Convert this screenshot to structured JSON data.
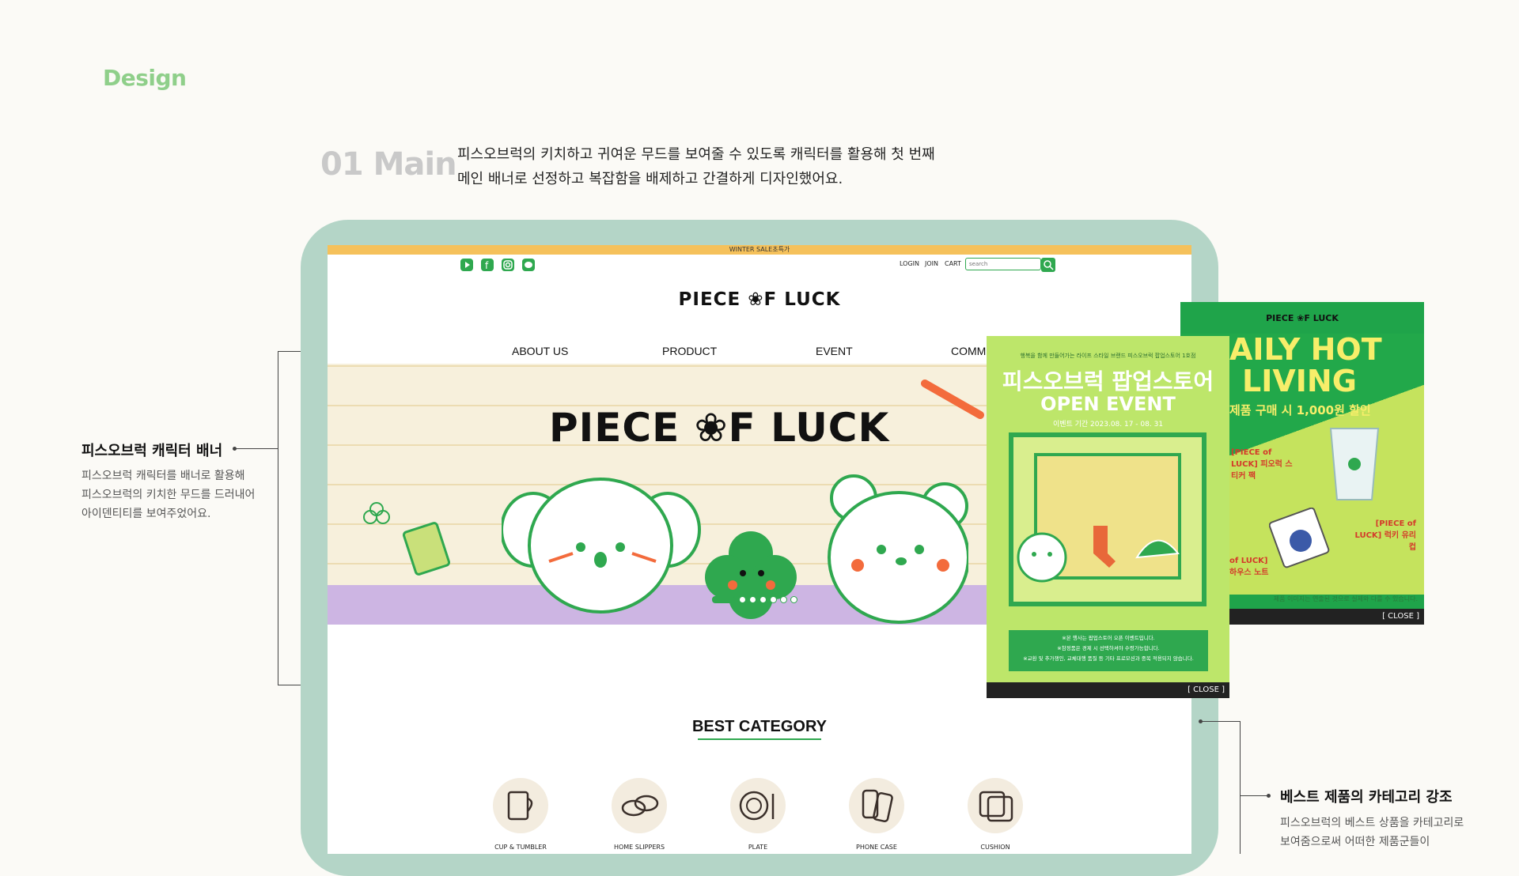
{
  "section": "Design",
  "number": "01 Main",
  "intro": [
    "피스오브럭의 키치하고 귀여운 무드를 보여줄 수 있도록 캐릭터를 활용해 첫 번째",
    "메인 배너로 선정하고 복잡함을 배제하고 간결하게 디자인했어요."
  ],
  "annotations": {
    "left": {
      "title": "피스오브럭 캐릭터 배너",
      "lines": [
        "피스오브럭 캐릭터를 배너로 활용해",
        "피스오브럭의 키치한 무드를 드러내어",
        "아이덴티티를 보여주었어요."
      ]
    },
    "right": {
      "title": "베스트 제품의 카테고리 강조",
      "lines": [
        "피스오브럭의 베스트 상품을 카테고리로",
        "보여줌으로써 어떠한 제품군들이"
      ]
    }
  },
  "site": {
    "promo_bar": "WINTER SALE초특가",
    "social_icons": [
      "youtube-icon",
      "facebook-icon",
      "instagram-icon",
      "talk-icon"
    ],
    "util_links": [
      "LOGIN",
      "JOIN",
      "CART"
    ],
    "search_placeholder": "search",
    "logo": "PIECE ❀F LUCK",
    "nav": [
      "ABOUT US",
      "PRODUCT",
      "EVENT",
      "COMMU"
    ],
    "banner_logo": "PIECE ❀F LUCK",
    "slider": {
      "total": 7,
      "active": 1
    },
    "best_title": "BEST CATEGORY",
    "categories": [
      "CUP & TUMBLER",
      "HOME SLIPPERS",
      "PLATE",
      "PHONE CASE",
      "CUSHION"
    ]
  },
  "popup1": {
    "tagline": "행복을 함께 만들어가는 라이프 스타일 브랜드 피스오브럭 팝업스토어 1호점",
    "title": "피스오브럭 팝업스토어",
    "subtitle": "OPEN EVENT",
    "date": "이벤트 기간 2023.08. 17 - 08. 31",
    "notes": [
      "※본 행사는 팝업스토어 오픈 이벤트입니다.",
      "※참정품은 경제 시 선택하셔야 수령가능합니다.",
      "※교환 및 추가챙인, 교체대행 품질 등 기타 프로모션과 중복 적용되지 않습니다."
    ],
    "close": "[ CLOSE ]"
  },
  "popup2": {
    "logo": "PIECE ❀F LUCK",
    "title_line1": "AILY HOT",
    "title_line2": "LIVING",
    "subtitle": "제품 구매 시 1,000원 할인",
    "label_sticker": "[PIECE of LUCK] 피오럭 스티커 팩",
    "label_cup": "[PIECE of LUCK] 럭키 유리컵",
    "label_note": "of LUCK] 하우스 노트",
    "note": "제품 이미지는 연출된 것으로 실제와 다를 수 있습니다.",
    "close": "[ CLOSE ]"
  },
  "colors": {
    "accent": "#2fa84f",
    "tablet": "#b4d5c7",
    "promo": "#f5c15b",
    "banner_bg": "#f7f0dc",
    "floor": "#cdb5e3"
  }
}
